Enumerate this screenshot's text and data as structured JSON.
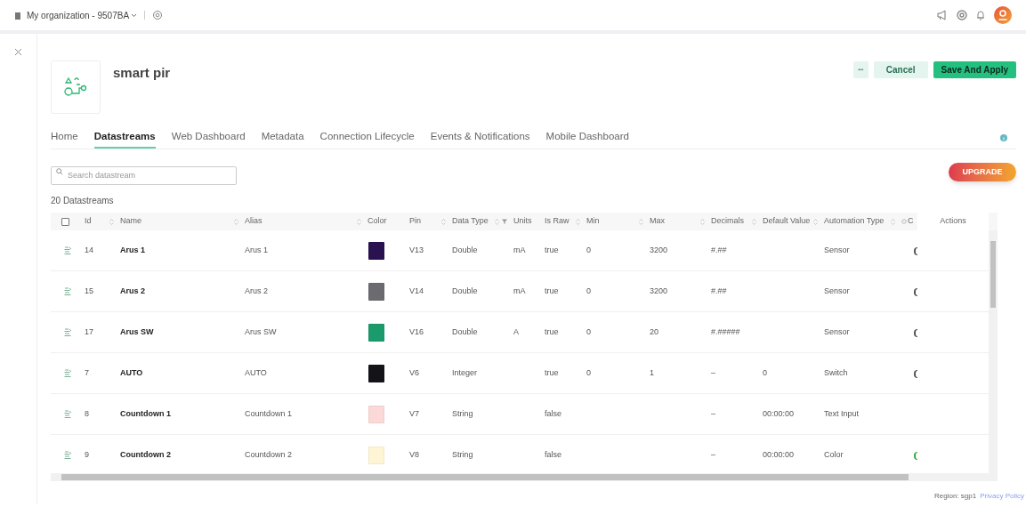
{
  "top_bar": {
    "organization": "My organization - 9507BA"
  },
  "template": {
    "title": "smart pir"
  },
  "header_buttons": [
    {
      "kind": "more",
      "label": "•••"
    },
    {
      "kind": "secondary",
      "label": "Cancel"
    },
    {
      "kind": "primary",
      "label": "Save And Apply"
    }
  ],
  "tabs": [
    {
      "label": "Home",
      "selected": false
    },
    {
      "label": "Datastreams",
      "selected": true
    },
    {
      "label": "Web Dashboard",
      "selected": false
    },
    {
      "label": "Metadata",
      "selected": false
    },
    {
      "label": "Connection Lifecycle",
      "selected": false
    },
    {
      "label": "Events & Notifications",
      "selected": false
    },
    {
      "label": "Mobile Dashboard",
      "selected": false
    }
  ],
  "search": {
    "placeholder": "Search datastream"
  },
  "upgrade_button": "UPGRADE",
  "count": "20 Datastreams",
  "table": {
    "select_all": {
      "checked": false
    },
    "columns": [
      {
        "label": "Id",
        "sortable": true
      },
      {
        "label": "Name",
        "sortable": true
      },
      {
        "label": "Alias",
        "sortable": true
      },
      {
        "label": "Color",
        "sortable": false
      },
      {
        "label": "Pin",
        "sortable": true
      },
      {
        "label": "Data Type",
        "sortable": true,
        "filter": true
      },
      {
        "label": "Units",
        "sortable": false
      },
      {
        "label": "Is Raw",
        "sortable": true
      },
      {
        "label": "Min",
        "sortable": true
      },
      {
        "label": "Max",
        "sortable": true
      },
      {
        "label": "Decimals",
        "sortable": true
      },
      {
        "label": "Default Value",
        "sortable": true
      },
      {
        "label": "Automation Type",
        "sortable": true
      },
      {
        "label": "C",
        "sortable": false
      },
      {
        "label": "Actions",
        "sortable": false
      }
    ],
    "rows": [
      {
        "id": "14",
        "name": "Arus 1",
        "alias": "Arus 1",
        "color": "#2a1150",
        "pin": "V13",
        "data_type": "Double",
        "units": "mA",
        "is_raw": "true",
        "min": "0",
        "max": "3200",
        "decimals": "#.##",
        "automation_type": "Sensor",
        "column_15": {
          "color": "#555555"
        }
      },
      {
        "id": "15",
        "name": "Arus 2",
        "alias": "Arus 2",
        "color": "#6b6b70",
        "pin": "V14",
        "data_type": "Double",
        "units": "mA",
        "is_raw": "true",
        "min": "0",
        "max": "3200",
        "decimals": "#.##",
        "automation_type": "Sensor",
        "column_15": {
          "color": "#555555"
        }
      },
      {
        "id": "17",
        "name": "Arus SW",
        "alias": "Arus SW",
        "color": "#1b9a6c",
        "pin": "V16",
        "data_type": "Double",
        "units": "A",
        "is_raw": "true",
        "min": "0",
        "max": "20",
        "decimals": "#.#####",
        "automation_type": "Sensor",
        "column_15": {
          "color": "#555555"
        }
      },
      {
        "id": "7",
        "name": "AUTO",
        "alias": "AUTO",
        "color": "#131318",
        "pin": "V6",
        "data_type": "Integer",
        "is_raw": "true",
        "min": "0",
        "max": "1",
        "decimals": "–",
        "default_value": "0",
        "automation_type": "Switch",
        "column_15": {
          "color": "#555555"
        }
      },
      {
        "id": "8",
        "name": "Countdown 1",
        "alias": "Countdown 1",
        "color": "#fbd9d9",
        "pin": "V7",
        "data_type": "String",
        "is_raw": "false",
        "decimals": "–",
        "default_value": "00:00:00",
        "automation_type": "Text Input"
      },
      {
        "id": "9",
        "name": "Countdown 2",
        "alias": "Countdown 2",
        "color": "#fdf5d3",
        "pin": "V8",
        "data_type": "String",
        "is_raw": "false",
        "decimals": "–",
        "default_value": "00:00:00",
        "automation_type": "Color",
        "column_15": {
          "color": "#3aa845"
        }
      }
    ]
  },
  "footer": {
    "region": "Region: sgp1",
    "link": "Privacy Policy"
  }
}
